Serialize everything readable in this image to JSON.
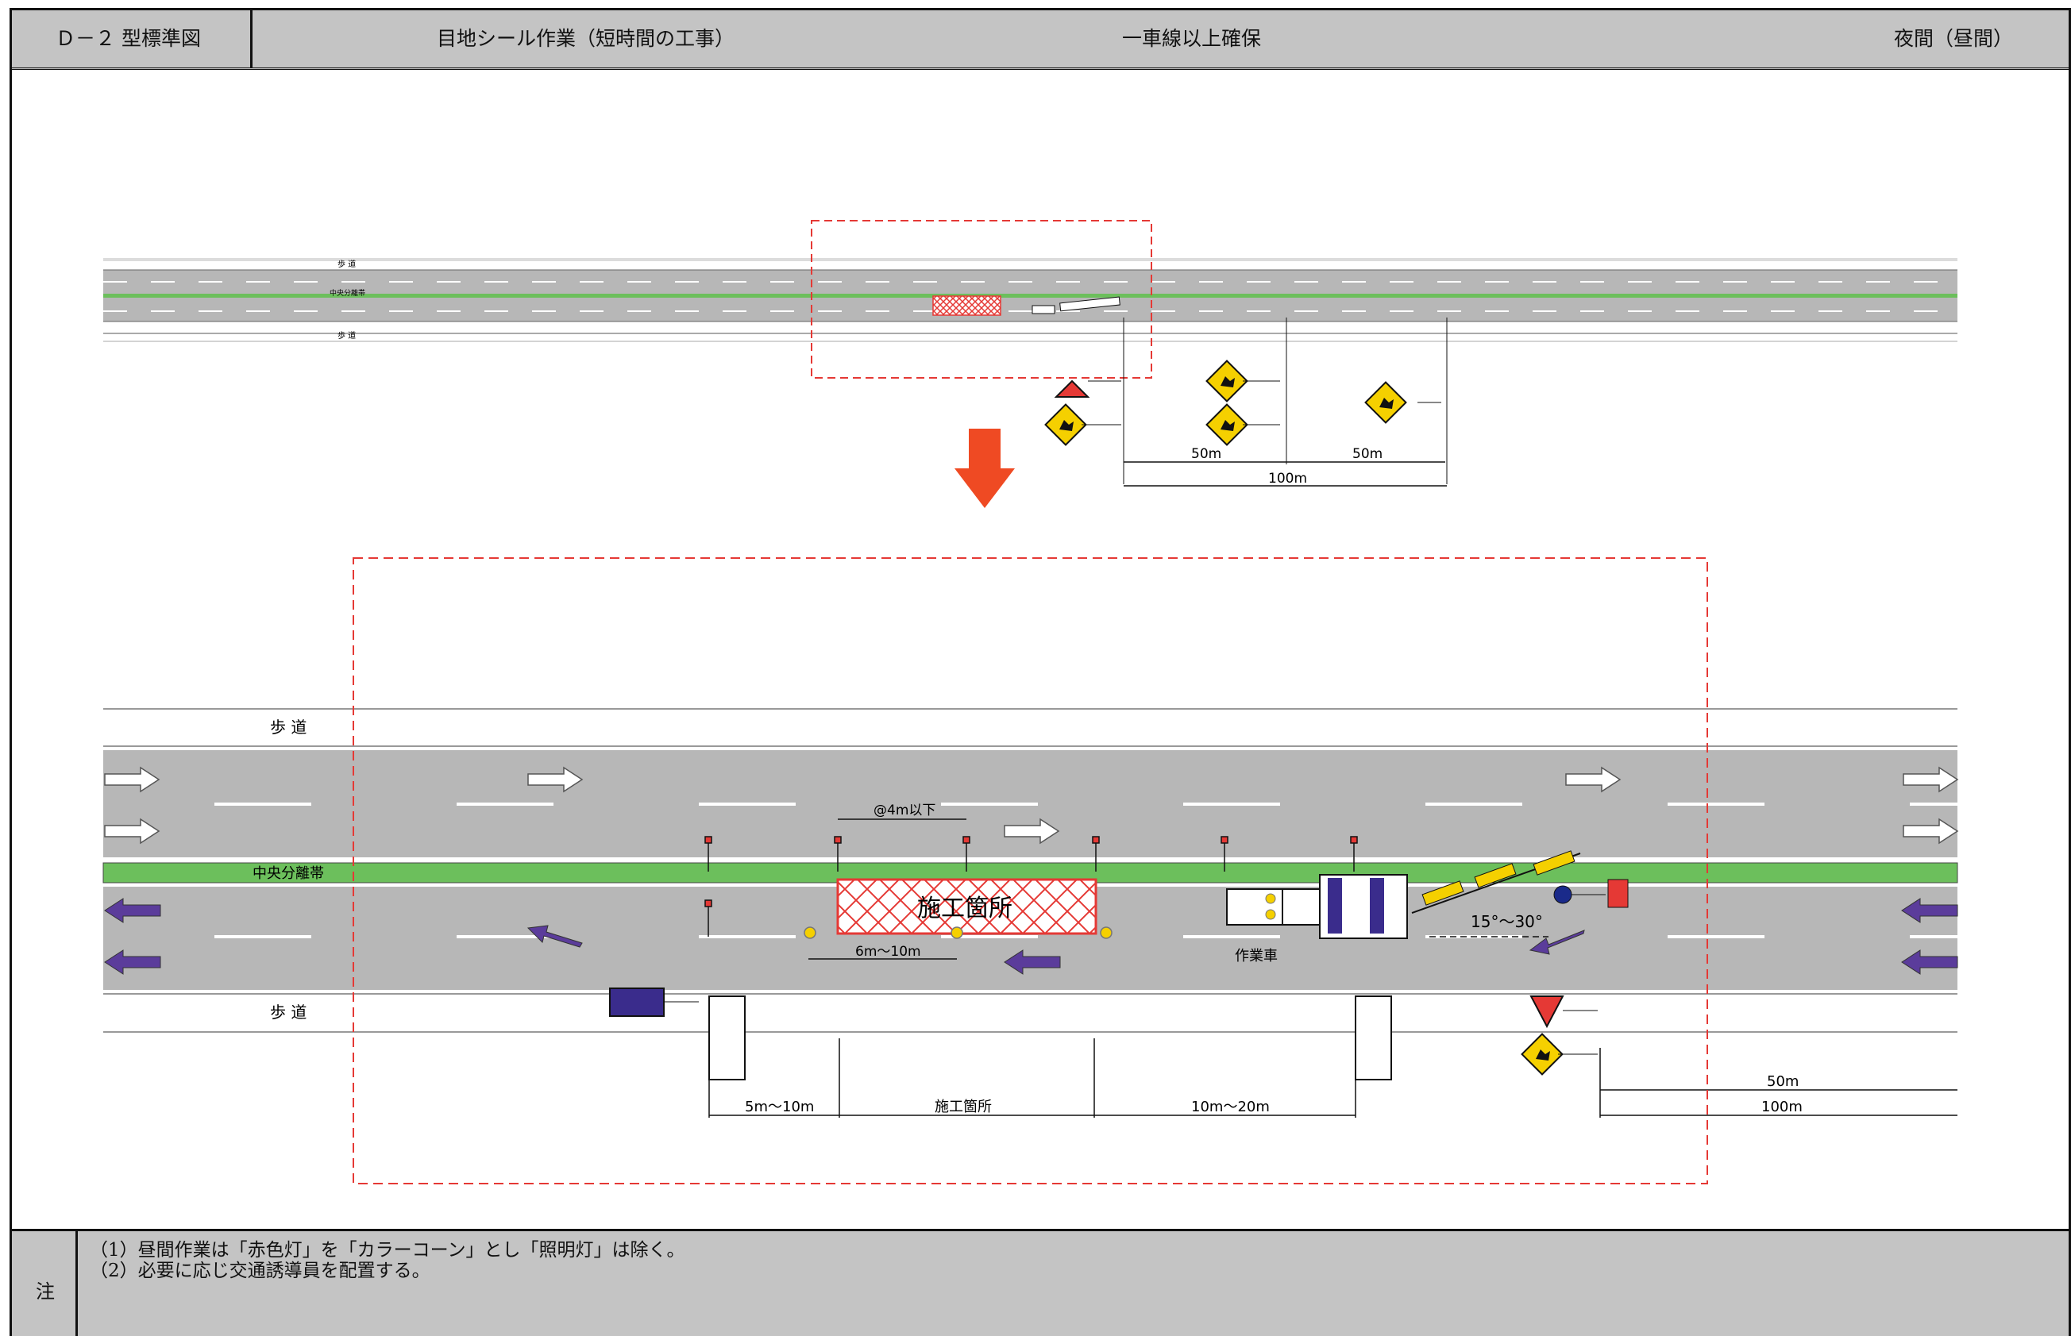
{
  "header": {
    "code": "Ｄ－２ 型標準図",
    "work_type": "目地シール作業（短時間の工事）",
    "lane_condition": "一車線以上確保",
    "time": "夜間（昼間）"
  },
  "top_map": {
    "sidewalk_top": "歩 道",
    "median": "中央分離帯",
    "sidewalk_bottom": "歩 道",
    "dim_50a": "50m",
    "dim_50b": "50m",
    "dim_100": "100m"
  },
  "detail": {
    "sidewalk_top": "歩 道",
    "median": "中央分離帯",
    "sidewalk_bottom": "歩 道",
    "work_area": "施工箇所",
    "spacing": "@4m以下",
    "dim_6_10": "6m～10m",
    "vehicle": "作業車",
    "angle": "15°～30°",
    "dim_5_10": "5m～10m",
    "dim_work": "施工箇所",
    "dim_10_20": "10m～20m",
    "dim_50": "50m",
    "dim_100": "100m"
  },
  "footer": {
    "label": "注",
    "note1": "（1）昼間作業は「赤色灯」を「カラーコーン」とし「照明灯」は除く。",
    "note2": "（2）必要に応じ交通誘導員を配置する。"
  },
  "colors": {
    "road": "#b7b7b7",
    "median": "#6cbf5c",
    "zone_border": "#e53935",
    "arrow_down": "#ef4a23",
    "traffic_arrow": "#5b3c9b",
    "sign_yellow": "#f5d000",
    "header_bg": "#c4c4c4"
  }
}
